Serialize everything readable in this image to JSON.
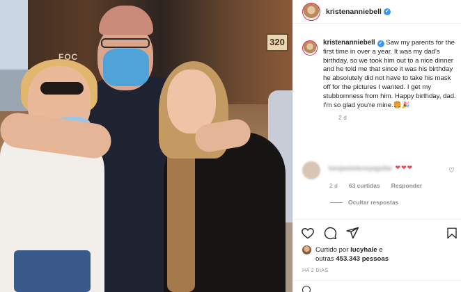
{
  "post": {
    "author": "kristenanniebell",
    "caption": "Saw my parents for the first time in over a year. It was my dad's birthday, so we took him out to a nice dinner and he told me that since it was his birthday he absolutely did not have to take his mask off for the pictures I wanted. I get my stubbornness from him. Happy birthday, dad. I'm so glad you're mine.🍔🎉",
    "caption_time": "2 d"
  },
  "photo": {
    "shop_sign": "320",
    "shop_text": "FOC"
  },
  "comment": {
    "author": "benjaminleveyaguilar",
    "hearts": "❤❤❤",
    "time": "2 d",
    "likes": "63 curtidas",
    "reply": "Responder",
    "hide_replies": "Ocultar respostas"
  },
  "likes": {
    "prefix": "Curtido por",
    "user": "lucyhale",
    "middle": "e",
    "line2_prefix": "outras",
    "count": "453.343 pessoas"
  },
  "date": "HÁ 2 DIAS",
  "icons": {
    "like": "heart-icon",
    "comment": "comment-icon",
    "share": "paper-plane-icon",
    "save": "bookmark-icon",
    "verified": "verified-badge-icon"
  },
  "colors": {
    "verified": "#3897f0",
    "heart": "#ed4956",
    "muted": "#8e8e8e",
    "text": "#262626"
  }
}
